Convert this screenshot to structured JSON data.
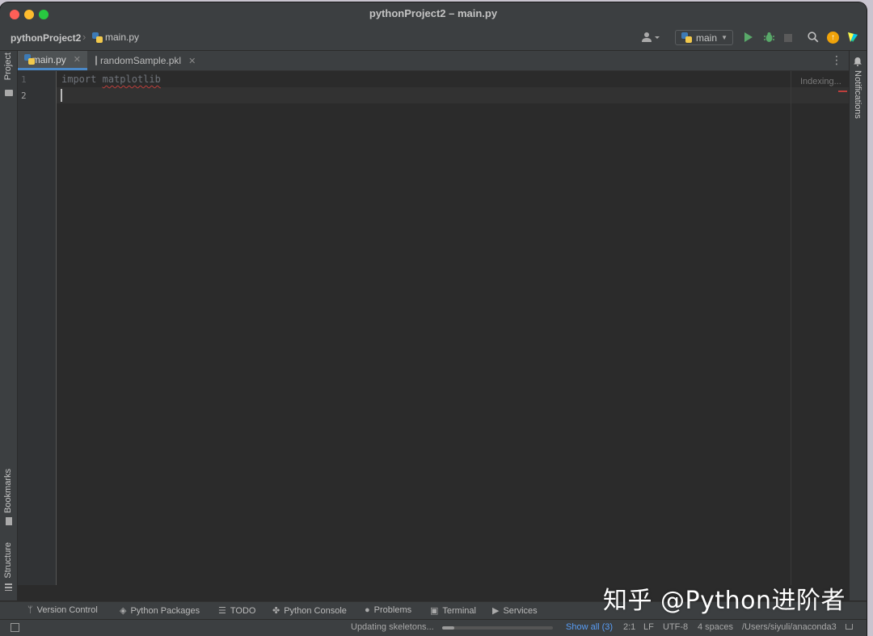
{
  "window": {
    "title": "pythonProject2 – main.py"
  },
  "breadcrumb": {
    "project": "pythonProject2",
    "file": "main.py"
  },
  "toolbar": {
    "run_config": "main"
  },
  "tabs": [
    {
      "label": "main.py",
      "active": true
    },
    {
      "label": "randomSample.pkl",
      "active": false
    }
  ],
  "side_tools": {
    "left_top": "Project",
    "left_bookmarks": "Bookmarks",
    "left_structure": "Structure",
    "right": "Notifications"
  },
  "editor": {
    "line_numbers": [
      "1",
      "2"
    ],
    "code_keyword": "import",
    "code_module": "matplotlib",
    "indexing_status": "Indexing..."
  },
  "bottom_tools": [
    {
      "label": "Version Control",
      "icon": "branch-icon"
    },
    {
      "label": "Python Packages",
      "icon": "layers-icon"
    },
    {
      "label": "TODO",
      "icon": "list-icon"
    },
    {
      "label": "Python Console",
      "icon": "python-icon"
    },
    {
      "label": "Problems",
      "icon": "info-icon"
    },
    {
      "label": "Terminal",
      "icon": "terminal-icon"
    },
    {
      "label": "Services",
      "icon": "services-icon"
    }
  ],
  "status": {
    "task": "Updating skeletons...",
    "progress": 0.11,
    "show_all": "Show all (3)",
    "position": "2:1",
    "line_sep": "LF",
    "encoding": "UTF-8",
    "indent": "4 spaces",
    "interpreter": "/Users/siyuli/anaconda3"
  },
  "watermark": "知乎 @Python进阶者",
  "colors": {
    "accent": "#4a88c7",
    "run": "#59a869",
    "error": "#bc3f3c",
    "link": "#589df6"
  }
}
